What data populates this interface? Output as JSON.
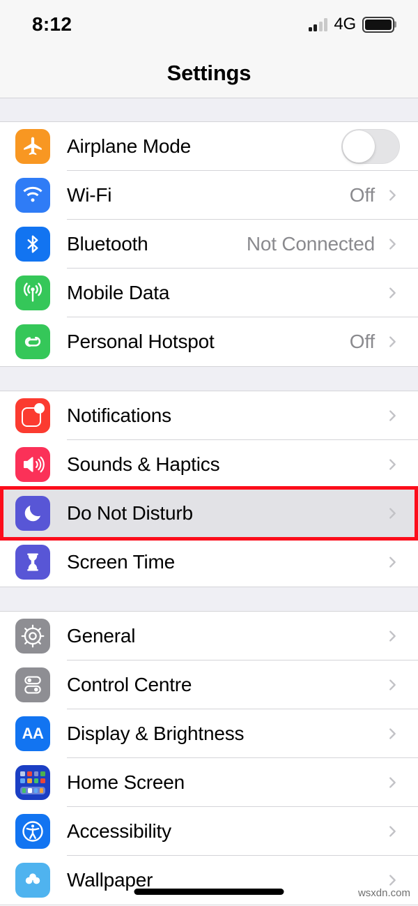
{
  "status_bar": {
    "time": "8:12",
    "network_type": "4G",
    "signal_icon": "cellular-signal-icon",
    "signal_bars_total": 4,
    "signal_bars_active": 2,
    "battery_icon": "battery-icon",
    "battery_level_percent": 88
  },
  "nav": {
    "title": "Settings"
  },
  "groups": [
    {
      "id": "connectivity",
      "rows": [
        {
          "label": "Airplane Mode",
          "icon": "airplane-icon",
          "icon_class": "ic-airplane",
          "accessory": "toggle",
          "toggle_on": false,
          "value": ""
        },
        {
          "label": "Wi-Fi",
          "icon": "wifi-icon",
          "icon_class": "ic-wifi",
          "accessory": "chevron",
          "value": "Off"
        },
        {
          "label": "Bluetooth",
          "icon": "bluetooth-icon",
          "icon_class": "ic-bt",
          "accessory": "chevron",
          "value": "Not Connected"
        },
        {
          "label": "Mobile Data",
          "icon": "mobile-data-icon",
          "icon_class": "ic-cell",
          "accessory": "chevron",
          "value": ""
        },
        {
          "label": "Personal Hotspot",
          "icon": "hotspot-icon",
          "icon_class": "ic-hotspot",
          "accessory": "chevron",
          "value": "Off"
        }
      ]
    },
    {
      "id": "notifications",
      "rows": [
        {
          "label": "Notifications",
          "icon": "notifications-icon",
          "icon_class": "ic-notif",
          "accessory": "chevron",
          "value": ""
        },
        {
          "label": "Sounds & Haptics",
          "icon": "sounds-icon",
          "icon_class": "ic-sounds",
          "accessory": "chevron",
          "value": ""
        },
        {
          "label": "Do Not Disturb",
          "icon": "moon-icon",
          "icon_class": "ic-dnd",
          "accessory": "chevron",
          "value": "",
          "highlighted": true
        },
        {
          "label": "Screen Time",
          "icon": "hourglass-icon",
          "icon_class": "ic-screen",
          "accessory": "chevron",
          "value": ""
        }
      ]
    },
    {
      "id": "system",
      "rows": [
        {
          "label": "General",
          "icon": "gear-icon",
          "icon_class": "ic-general",
          "accessory": "chevron",
          "value": ""
        },
        {
          "label": "Control Centre",
          "icon": "control-centre-icon",
          "icon_class": "ic-control",
          "accessory": "chevron",
          "value": ""
        },
        {
          "label": "Display & Brightness",
          "icon": "display-brightness-icon",
          "icon_class": "ic-display",
          "accessory": "chevron",
          "value": ""
        },
        {
          "label": "Home Screen",
          "icon": "home-screen-icon",
          "icon_class": "ic-home",
          "accessory": "chevron",
          "value": ""
        },
        {
          "label": "Accessibility",
          "icon": "accessibility-icon",
          "icon_class": "ic-access",
          "accessory": "chevron",
          "value": ""
        },
        {
          "label": "Wallpaper",
          "icon": "wallpaper-icon",
          "icon_class": "ic-wallpaper",
          "accessory": "chevron",
          "value": "",
          "partial": true
        }
      ]
    }
  ],
  "annotation": {
    "type": "red-rectangle-highlight",
    "target_label": "Do Not Disturb",
    "color": "#fc0d1b"
  },
  "watermark": {
    "text": "wsxdn.com"
  },
  "colors": {
    "accent_blue": "#1274f1",
    "green": "#35c759",
    "orange": "#f89722",
    "red": "#fb3b30",
    "pink": "#fb3158",
    "purple": "#5856d6",
    "gray": "#8e8e93",
    "group_background": "#efeff4",
    "separator": "#d4d4d8",
    "highlight_row": "#e2e2e6",
    "annotation_red": "#fc0d1b"
  }
}
